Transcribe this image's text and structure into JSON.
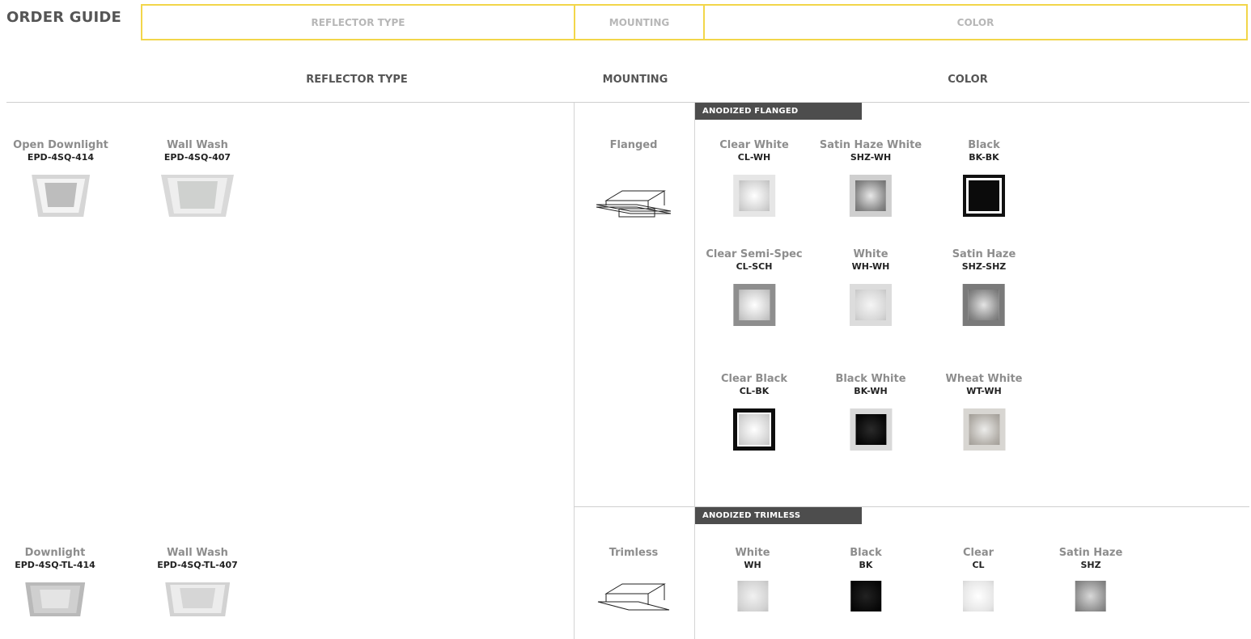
{
  "header": {
    "title": "ORDER GUIDE",
    "tabs": [
      "REFLECTOR TYPE",
      "MOUNTING",
      "COLOR"
    ]
  },
  "columns": {
    "reflector": "REFLECTOR TYPE",
    "mounting": "MOUNTING",
    "color": "COLOR"
  },
  "flanged": {
    "mounting_label": "Flanged",
    "section_label": "ANODIZED FLANGED",
    "reflectors": [
      {
        "name": "Open Downlight",
        "code": "EPD-4SQ-414"
      },
      {
        "name": "Wall Wash",
        "code": "EPD-4SQ-407"
      }
    ],
    "colors": [
      {
        "name": "Clear White",
        "code": "CL-WH"
      },
      {
        "name": "Satin Haze White",
        "code": "SHZ-WH"
      },
      {
        "name": "Black",
        "code": "BK-BK"
      },
      {
        "name": "Clear Semi-Spec",
        "code": "CL-SCH"
      },
      {
        "name": "White",
        "code": "WH-WH"
      },
      {
        "name": "Satin Haze",
        "code": "SHZ-SHZ"
      },
      {
        "name": "Clear Black",
        "code": "CL-BK"
      },
      {
        "name": "Black White",
        "code": "BK-WH"
      },
      {
        "name": "Wheat White",
        "code": "WT-WH"
      }
    ]
  },
  "trimless": {
    "mounting_label": "Trimless",
    "section_label": "ANODIZED TRIMLESS",
    "reflectors": [
      {
        "name": "Downlight",
        "code": "EPD-4SQ-TL-414"
      },
      {
        "name": "Wall Wash",
        "code": "EPD-4SQ-TL-407"
      }
    ],
    "colors": [
      {
        "name": "White",
        "code": "WH"
      },
      {
        "name": "Black",
        "code": "BK"
      },
      {
        "name": "Clear",
        "code": "CL"
      },
      {
        "name": "Satin Haze",
        "code": "SHZ"
      }
    ]
  },
  "palette": {
    "accent_border": "#f2d64a",
    "section_bar": "#4d4d4d"
  }
}
